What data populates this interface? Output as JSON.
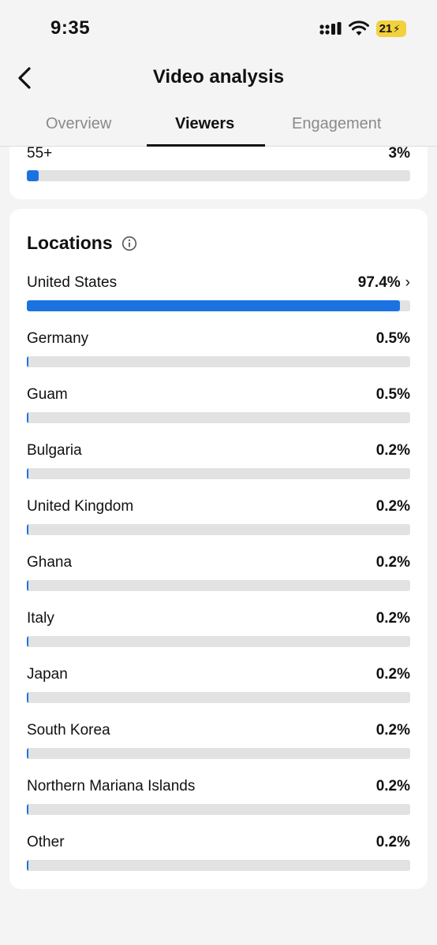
{
  "status_bar": {
    "time": "9:35",
    "battery": "21"
  },
  "nav": {
    "title": "Video analysis"
  },
  "tabs": [
    {
      "label": "Overview",
      "active": false
    },
    {
      "label": "Viewers",
      "active": true
    },
    {
      "label": "Engagement",
      "active": false
    }
  ],
  "age_row": {
    "label": "55+",
    "value": "3%",
    "percent": 3
  },
  "locations": {
    "title": "Locations",
    "rows": [
      {
        "label": "United States",
        "value": "97.4%",
        "percent": 97.4,
        "chevron": "›"
      },
      {
        "label": "Germany",
        "value": "0.5%",
        "percent": 0.5
      },
      {
        "label": "Guam",
        "value": "0.5%",
        "percent": 0.5
      },
      {
        "label": "Bulgaria",
        "value": "0.2%",
        "percent": 0.2
      },
      {
        "label": "United Kingdom",
        "value": "0.2%",
        "percent": 0.2
      },
      {
        "label": "Ghana",
        "value": "0.2%",
        "percent": 0.2
      },
      {
        "label": "Italy",
        "value": "0.2%",
        "percent": 0.2
      },
      {
        "label": "Japan",
        "value": "0.2%",
        "percent": 0.2
      },
      {
        "label": "South Korea",
        "value": "0.2%",
        "percent": 0.2
      },
      {
        "label": "Northern Mariana Islands",
        "value": "0.2%",
        "percent": 0.2
      },
      {
        "label": "Other",
        "value": "0.2%",
        "percent": 0.2
      }
    ]
  },
  "colors": {
    "accent": "#1a73e0",
    "track": "#e2e2e2",
    "battery": "#f2d13c"
  },
  "icons": {
    "back": "chevron-left-icon",
    "info": "info-circle-icon",
    "signal": "cellular-signal-icon",
    "wifi": "wifi-icon"
  }
}
